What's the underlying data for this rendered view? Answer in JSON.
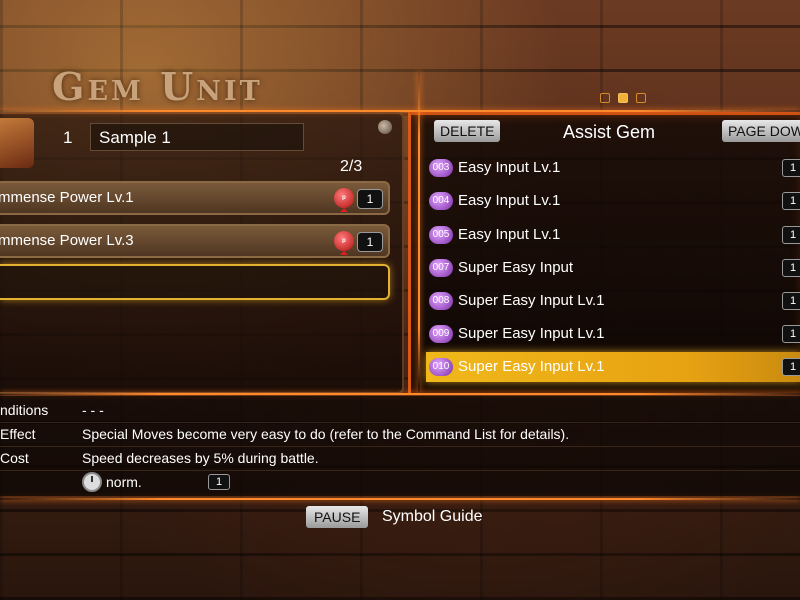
{
  "header": {
    "title": "Gem Unit",
    "page_count": 3,
    "active_page": 2
  },
  "left": {
    "slot_number": "1",
    "name": "Sample 1",
    "count": "2/3",
    "equipped": [
      {
        "label": "mmense Power Lv.1",
        "badge": "1",
        "icon": "red-gem-icon"
      },
      {
        "label": "mmense Power Lv.3",
        "badge": "1",
        "icon": "red-gem-icon"
      }
    ]
  },
  "right": {
    "delete_label": "DELETE",
    "title": "Assist Gem",
    "pagedown_label": "PAGE DOW",
    "items": [
      {
        "id": "003",
        "label": "Easy Input Lv.1",
        "badge": "1"
      },
      {
        "id": "004",
        "label": "Easy Input Lv.1",
        "badge": "1"
      },
      {
        "id": "005",
        "label": "Easy Input Lv.1",
        "badge": "1"
      },
      {
        "id": "007",
        "label": "Super Easy Input",
        "badge": "1"
      },
      {
        "id": "008",
        "label": "Super Easy Input Lv.1",
        "badge": "1"
      },
      {
        "id": "009",
        "label": "Super Easy Input Lv.1",
        "badge": "1"
      },
      {
        "id": "010",
        "label": "Super Easy Input Lv.1",
        "badge": "1",
        "selected": true
      }
    ]
  },
  "info": {
    "conditions_key": "nditions",
    "conditions_value": "- - -",
    "effect_key": "Effect",
    "effect_value": "Special Moves become very easy to do (refer to the Command List for details).",
    "cost_key": "Cost",
    "cost_value": "Speed decreases by 5% during battle.",
    "timing_value": "norm.",
    "timing_badge": "1"
  },
  "footer": {
    "pause_label": "PAUSE",
    "guide_label": "Symbol Guide"
  },
  "colors": {
    "accent": "#f0b81a",
    "glow": "#ff8a2a",
    "gem_purple": "#7b2ca8",
    "gem_red": "#b01010"
  }
}
